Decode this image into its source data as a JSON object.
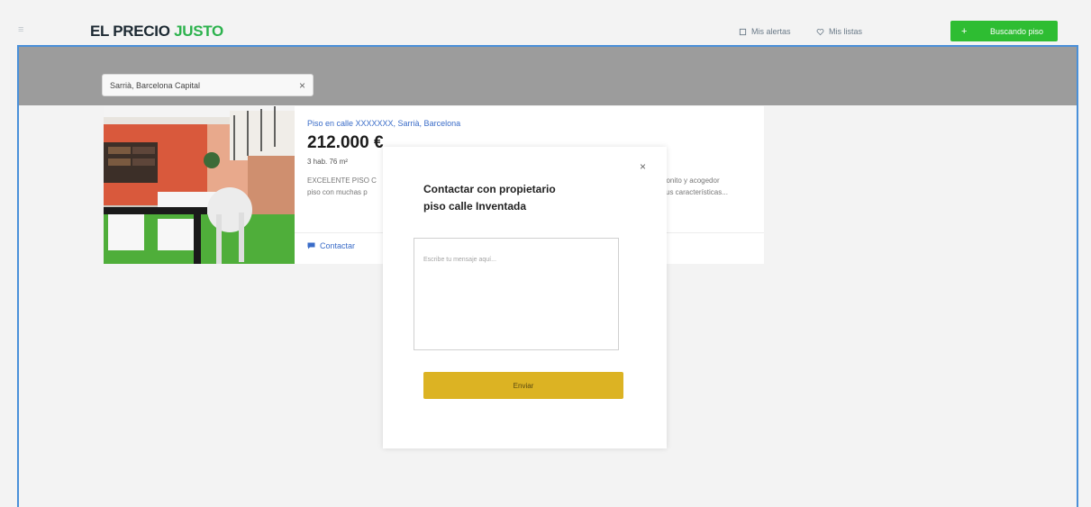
{
  "header": {
    "logo_part1": "EL PRECIO",
    "logo_part2": "JUSTO",
    "alerts_label": "Mis alertas",
    "favorites_label": "Mis listas",
    "publish_label": "Buscando piso",
    "publish_icon": "plus-icon"
  },
  "search": {
    "value": "Sarrià, Barcelona Capital",
    "clear_label": "×"
  },
  "listing": {
    "title": "Piso en calle XXXXXXX, Sarrià, Barcelona",
    "price": "212.000 €",
    "specs": "3 hab.  76 m²",
    "description_left": "EXCELENTE PISO C",
    "description_left2": "piso con muchas p",
    "description_right": "bonito y acogedor",
    "description_right2": "sus características...",
    "contact_label": "Contactar"
  },
  "modal": {
    "title_line1": "Contactar con propietario",
    "title_line2": "piso calle Inventada",
    "close_label": "×",
    "message_placeholder": "Escribe tu mensaje aquí...",
    "send_label": "Enviar"
  },
  "colors": {
    "brand_dark": "#1d2a33",
    "brand_green": "#2cb24d",
    "button_green": "#2ebd32",
    "frame_blue": "#4a90d9",
    "send_gold": "#dcb323",
    "link_blue": "#3a6cc8"
  }
}
